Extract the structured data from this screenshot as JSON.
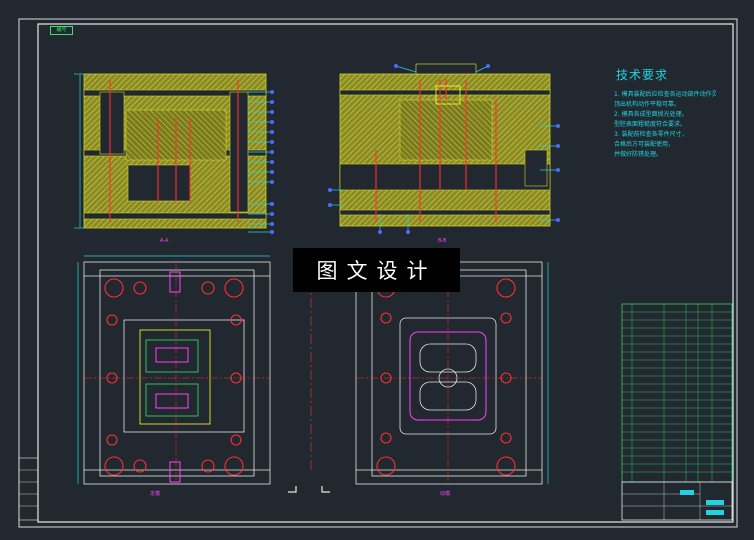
{
  "drawing": {
    "stamp": "编号",
    "watermark": "图文设计",
    "notes_title": "技术要求",
    "notes": [
      "1. 模具装配后应检查各运动部件动作灵活。",
      "   顶出机构动作平稳可靠。",
      "2. 模具各成型面抛光处理。",
      "   型腔表面粗糙度符合要求。",
      "3. 装配前检查各零件尺寸，",
      "   合格后方可装配使用，",
      "   并做好防锈处理。"
    ],
    "captions": {
      "section_a": "A-A",
      "section_b": "B-B",
      "bottom_left": "定模",
      "bottom_right": "动模"
    },
    "colors": {
      "background": "#212830",
      "hatch": "#c8c83a",
      "redline": "#ff3030",
      "cyan": "#22d3e0",
      "leader_dot": "#4d6bff",
      "magenta": "#ff40ff"
    }
  }
}
